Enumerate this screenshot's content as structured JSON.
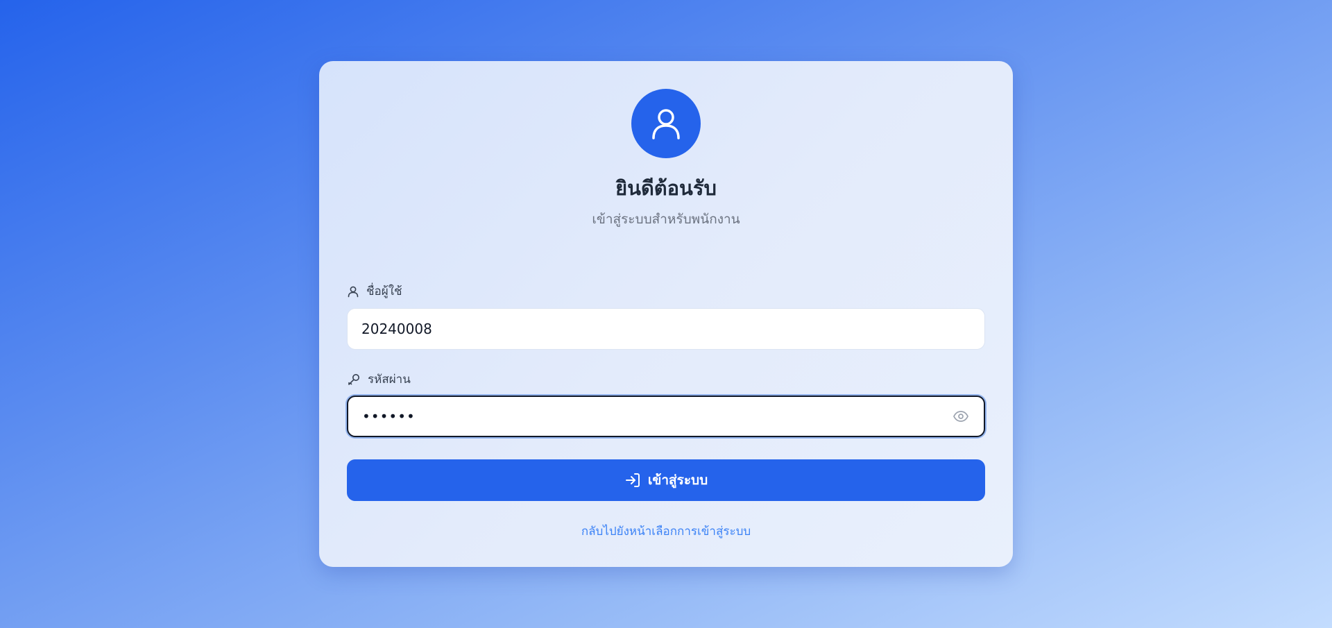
{
  "header": {
    "title": "ยินดีต้อนรับ",
    "subtitle": "เข้าสู่ระบบสำหรับพนักงาน",
    "avatar_icon": "user-icon"
  },
  "form": {
    "username": {
      "label": "ชื่อผู้ใช้",
      "icon": "user-icon",
      "value": "20240008"
    },
    "password": {
      "label": "รหัสผ่าน",
      "icon": "key-icon",
      "masked_value": "••••••",
      "toggle_icon": "eye-icon"
    },
    "submit": {
      "label": "เข้าสู่ระบบ",
      "icon": "login-arrow-icon"
    },
    "back_link": "กลับไปยังหน้าเลือกการเข้าสู่ระบบ"
  },
  "colors": {
    "accent": "#2563eb",
    "link": "#3b82f6",
    "title_text": "#1f2a3a",
    "subtitle_text": "#6b7280"
  }
}
